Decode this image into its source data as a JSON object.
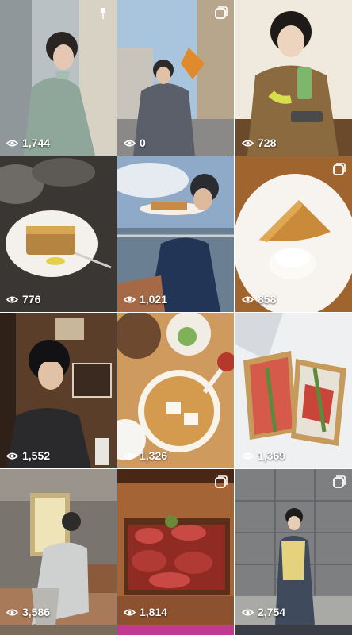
{
  "grid": {
    "tiles": [
      {
        "views": "1,744",
        "badge": "pin-icon"
      },
      {
        "views": "0",
        "badge": "carousel-icon"
      },
      {
        "views": "728",
        "badge": ""
      },
      {
        "views": "776",
        "badge": ""
      },
      {
        "views": "1,021",
        "badge": ""
      },
      {
        "views": "858",
        "badge": "carousel-icon"
      },
      {
        "views": "1,552",
        "badge": ""
      },
      {
        "views": "1,326",
        "badge": ""
      },
      {
        "views": "1,369",
        "badge": ""
      },
      {
        "views": "3,586",
        "badge": ""
      },
      {
        "views": "1,814",
        "badge": "carousel-icon"
      },
      {
        "views": "2,754",
        "badge": "carousel-icon"
      }
    ]
  }
}
